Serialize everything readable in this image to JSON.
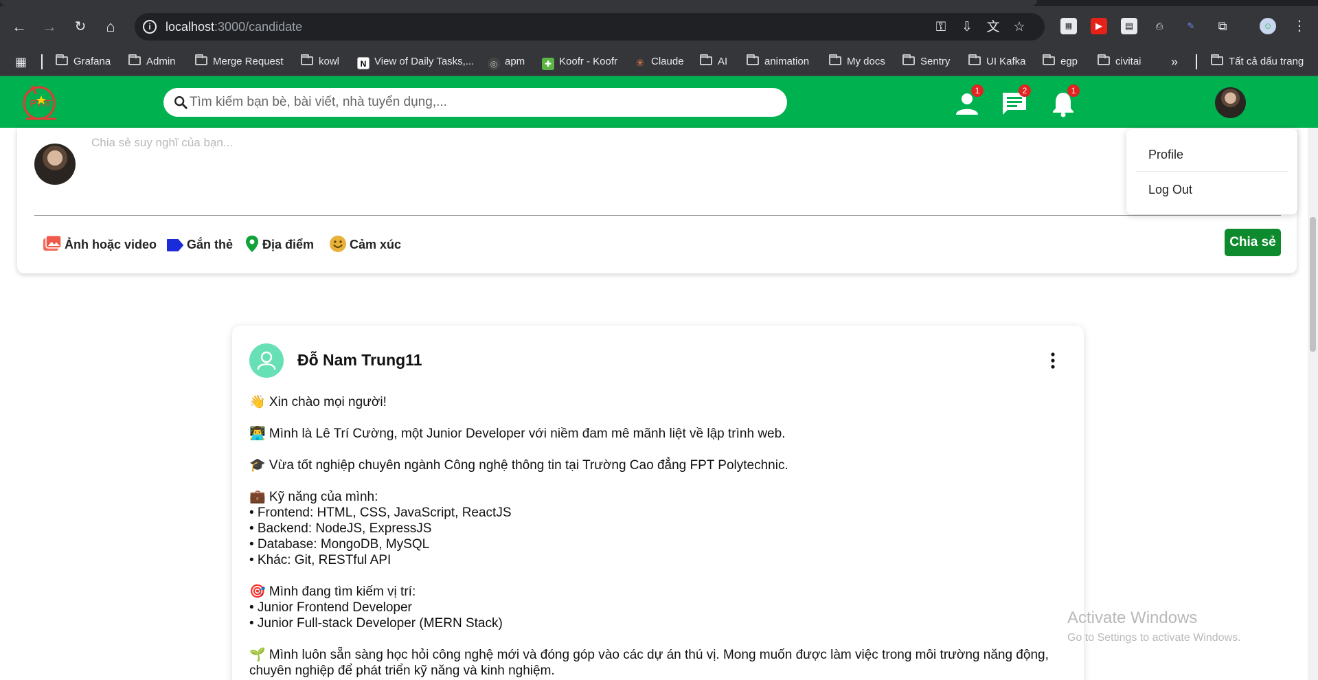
{
  "browser": {
    "url_host": "localhost",
    "url_path": ":3000/candidate",
    "bookmarks": [
      {
        "label": "Grafana",
        "icon": "folder-icon"
      },
      {
        "label": "Admin",
        "icon": "folder-icon"
      },
      {
        "label": "Merge Request",
        "icon": "folder-icon"
      },
      {
        "label": "kowl",
        "icon": "folder-icon"
      },
      {
        "label": "View of Daily Tasks,...",
        "icon": "notion-icon"
      },
      {
        "label": "apm",
        "icon": "apm-icon"
      },
      {
        "label": "Koofr - Koofr",
        "icon": "koofr-icon"
      },
      {
        "label": "Claude",
        "icon": "claude-icon"
      },
      {
        "label": "AI",
        "icon": "folder-icon"
      },
      {
        "label": "animation",
        "icon": "folder-icon"
      },
      {
        "label": "My docs",
        "icon": "folder-icon"
      },
      {
        "label": "Sentry",
        "icon": "folder-icon"
      },
      {
        "label": "UI Kafka",
        "icon": "folder-icon"
      },
      {
        "label": "egp",
        "icon": "folder-icon"
      },
      {
        "label": "civitai",
        "icon": "folder-icon"
      }
    ],
    "overflow_label": "»",
    "all_bookmarks": "Tất cả dấu trang"
  },
  "header": {
    "logo_text": "PTIT",
    "search_placeholder": "Tìm kiếm bạn bè, bài viết, nhà tuyển dụng,...",
    "friends_badge": "1",
    "messages_badge": "2",
    "notifications_badge": "1"
  },
  "composer": {
    "placeholder": "Chia sẻ suy nghĩ của bạn...",
    "actions": {
      "media": "Ảnh hoặc video",
      "tag": "Gắn thẻ",
      "location": "Địa điểm",
      "feeling": "Cảm xúc"
    },
    "share_label": "Chia sẻ"
  },
  "dropdown": {
    "profile": "Profile",
    "logout": "Log Out"
  },
  "post": {
    "author": "Đỗ Nam Trung11",
    "paragraphs": [
      "👋 Xin chào mọi người!",
      "👨‍💻 Mình là Lê Trí Cường, một Junior Developer với niềm đam mê mãnh liệt về lập trình web.",
      "🎓 Vừa tốt nghiệp chuyên ngành Công nghệ thông tin tại Trường Cao đẳng FPT Polytechnic.",
      "💼 Kỹ năng của mình:\n• Frontend: HTML, CSS, JavaScript, ReactJS\n• Backend: NodeJS, ExpressJS\n• Database: MongoDB, MySQL\n• Khác: Git, RESTful API",
      "🎯 Mình đang tìm kiếm vị trí:\n• Junior Frontend Developer\n• Junior Full-stack Developer (MERN Stack)",
      "🌱 Mình luôn sẵn sàng học hỏi công nghệ mới và đóng góp vào các dự án thú vị. Mong muốn được làm việc trong môi trường năng động, chuyên nghiệp để phát triển kỹ năng và kinh nghiệm."
    ]
  },
  "watermark": {
    "line1": "Activate Windows",
    "line2": "Go to Settings to activate Windows."
  },
  "colors": {
    "brand_green": "#00b14f",
    "share_green": "#0e8a2e",
    "badge_red": "#e32222"
  }
}
